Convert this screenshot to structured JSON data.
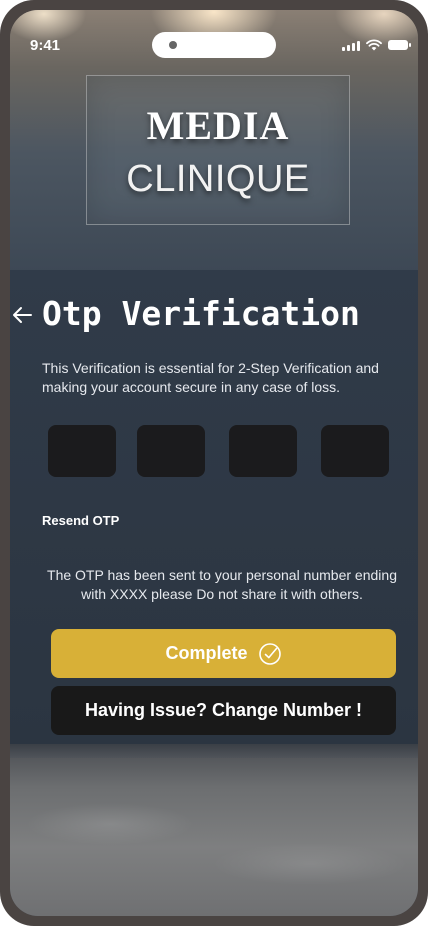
{
  "status_bar": {
    "time": "9:41"
  },
  "logo": {
    "title": "MEDIA",
    "subtitle": "CLINIQUE"
  },
  "otp": {
    "heading": "Otp Verification",
    "description": "This Verification is essential for 2-Step Verification and making your account secure in any case of loss.",
    "resend_label": "Resend OTP",
    "note": "The OTP has been sent to your personal number ending with XXXX please Do not share it with others.",
    "inputs": [
      "",
      "",
      "",
      ""
    ]
  },
  "buttons": {
    "complete_label": "Complete",
    "change_number_label": "Having Issue? Change Number !"
  },
  "icons": {
    "back": "arrow-left-icon",
    "complete": "check-circle-icon"
  },
  "colors": {
    "accent": "#d8b037",
    "panel": "#2e3845",
    "otp_box": "#1b1b1d",
    "secondary_button": "#191919"
  }
}
